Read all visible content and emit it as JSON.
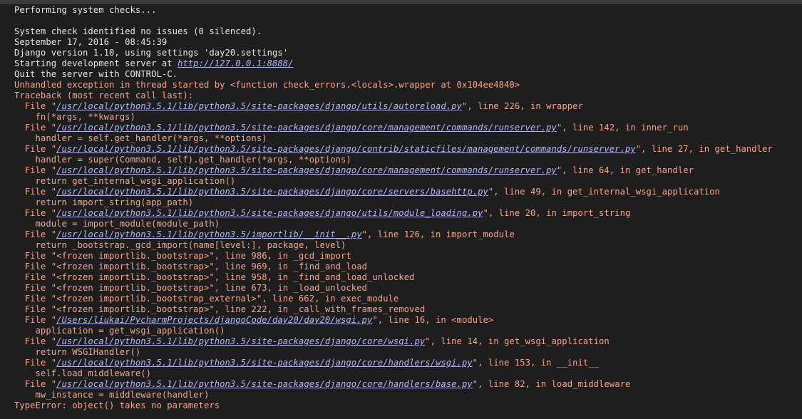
{
  "terminal": {
    "lines": [
      {
        "style": "white",
        "segments": [
          {
            "t": "Performing system checks..."
          }
        ]
      },
      {
        "style": "white",
        "segments": [
          {
            "t": ""
          }
        ]
      },
      {
        "style": "white",
        "segments": [
          {
            "t": "System check identified no issues (0 silenced)."
          }
        ]
      },
      {
        "style": "white",
        "segments": [
          {
            "t": "September 17, 2016 - 08:45:39"
          }
        ]
      },
      {
        "style": "white",
        "segments": [
          {
            "t": "Django version 1.10, using settings 'day20.settings'"
          }
        ]
      },
      {
        "style": "white",
        "segments": [
          {
            "t": "Starting development server at "
          },
          {
            "t": "http://127.0.0.1:8888/",
            "link": true
          }
        ]
      },
      {
        "style": "white",
        "segments": [
          {
            "t": "Quit the server with CONTROL-C."
          }
        ]
      },
      {
        "style": "red",
        "segments": [
          {
            "t": "Unhandled exception in thread started by <function check_errors.<locals>.wrapper at 0x104ee4840>"
          }
        ]
      },
      {
        "style": "red",
        "segments": [
          {
            "t": "Traceback (most recent call last):"
          }
        ]
      },
      {
        "style": "red",
        "segments": [
          {
            "t": "  File \""
          },
          {
            "t": "/usr/local/python3.5.1/lib/python3.5/site-packages/django/utils/autoreload.py",
            "link": true
          },
          {
            "t": "\", line 226, in wrapper"
          }
        ]
      },
      {
        "style": "red",
        "segments": [
          {
            "t": "    fn(*args, **kwargs)"
          }
        ]
      },
      {
        "style": "red",
        "segments": [
          {
            "t": "  File \""
          },
          {
            "t": "/usr/local/python3.5.1/lib/python3.5/site-packages/django/core/management/commands/runserver.py",
            "link": true
          },
          {
            "t": "\", line 142, in inner_run"
          }
        ]
      },
      {
        "style": "red",
        "segments": [
          {
            "t": "    handler = self.get_handler(*args, **options)"
          }
        ]
      },
      {
        "style": "red",
        "segments": [
          {
            "t": "  File \""
          },
          {
            "t": "/usr/local/python3.5.1/lib/python3.5/site-packages/django/contrib/staticfiles/management/commands/runserver.py",
            "link": true
          },
          {
            "t": "\", line 27, in get_handler"
          }
        ]
      },
      {
        "style": "red",
        "segments": [
          {
            "t": "    handler = super(Command, self).get_handler(*args, **options)"
          }
        ]
      },
      {
        "style": "red",
        "segments": [
          {
            "t": "  File \""
          },
          {
            "t": "/usr/local/python3.5.1/lib/python3.5/site-packages/django/core/management/commands/runserver.py",
            "link": true
          },
          {
            "t": "\", line 64, in get_handler"
          }
        ]
      },
      {
        "style": "red",
        "segments": [
          {
            "t": "    return get_internal_wsgi_application()"
          }
        ]
      },
      {
        "style": "red",
        "segments": [
          {
            "t": "  File \""
          },
          {
            "t": "/usr/local/python3.5.1/lib/python3.5/site-packages/django/core/servers/basehttp.py",
            "link": true
          },
          {
            "t": "\", line 49, in get_internal_wsgi_application"
          }
        ]
      },
      {
        "style": "red",
        "segments": [
          {
            "t": "    return import_string(app_path)"
          }
        ]
      },
      {
        "style": "red",
        "segments": [
          {
            "t": "  File \""
          },
          {
            "t": "/usr/local/python3.5.1/lib/python3.5/site-packages/django/utils/module_loading.py",
            "link": true
          },
          {
            "t": "\", line 20, in import_string"
          }
        ]
      },
      {
        "style": "red",
        "segments": [
          {
            "t": "    module = import_module(module_path)"
          }
        ]
      },
      {
        "style": "red",
        "segments": [
          {
            "t": "  File \""
          },
          {
            "t": "/usr/local/python3.5.1/lib/python3.5/importlib/__init__.py",
            "link": true
          },
          {
            "t": "\", line 126, in import_module"
          }
        ]
      },
      {
        "style": "red",
        "segments": [
          {
            "t": "    return _bootstrap._gcd_import(name[level:], package, level)"
          }
        ]
      },
      {
        "style": "red",
        "segments": [
          {
            "t": "  File \"<frozen importlib._bootstrap>\", line 986, in _gcd_import"
          }
        ]
      },
      {
        "style": "red",
        "segments": [
          {
            "t": "  File \"<frozen importlib._bootstrap>\", line 969, in _find_and_load"
          }
        ]
      },
      {
        "style": "red",
        "segments": [
          {
            "t": "  File \"<frozen importlib._bootstrap>\", line 958, in _find_and_load_unlocked"
          }
        ]
      },
      {
        "style": "red",
        "segments": [
          {
            "t": "  File \"<frozen importlib._bootstrap>\", line 673, in _load_unlocked"
          }
        ]
      },
      {
        "style": "red",
        "segments": [
          {
            "t": "  File \"<frozen importlib._bootstrap_external>\", line 662, in exec_module"
          }
        ]
      },
      {
        "style": "red",
        "segments": [
          {
            "t": "  File \"<frozen importlib._bootstrap>\", line 222, in _call_with_frames_removed"
          }
        ]
      },
      {
        "style": "red",
        "segments": [
          {
            "t": "  File \""
          },
          {
            "t": "/Users/liukai/PycharmProjects/djangoCode/day20/day20/wsgi.py",
            "link": true
          },
          {
            "t": "\", line 16, in <module>"
          }
        ]
      },
      {
        "style": "red",
        "segments": [
          {
            "t": "    application = get_wsgi_application()"
          }
        ]
      },
      {
        "style": "red",
        "segments": [
          {
            "t": "  File \""
          },
          {
            "t": "/usr/local/python3.5.1/lib/python3.5/site-packages/django/core/wsgi.py",
            "link": true
          },
          {
            "t": "\", line 14, in get_wsgi_application"
          }
        ]
      },
      {
        "style": "red",
        "segments": [
          {
            "t": "    return WSGIHandler()"
          }
        ]
      },
      {
        "style": "red",
        "segments": [
          {
            "t": "  File \""
          },
          {
            "t": "/usr/local/python3.5.1/lib/python3.5/site-packages/django/core/handlers/wsgi.py",
            "link": true
          },
          {
            "t": "\", line 153, in __init__"
          }
        ]
      },
      {
        "style": "red",
        "segments": [
          {
            "t": "    self.load_middleware()"
          }
        ]
      },
      {
        "style": "red",
        "segments": [
          {
            "t": "  File \""
          },
          {
            "t": "/usr/local/python3.5.1/lib/python3.5/site-packages/django/core/handlers/base.py",
            "link": true
          },
          {
            "t": "\", line 82, in load_middleware"
          }
        ]
      },
      {
        "style": "red",
        "segments": [
          {
            "t": "    mw_instance = middleware(handler)"
          }
        ]
      },
      {
        "style": "red",
        "segments": [
          {
            "t": "TypeError: object() takes no parameters"
          }
        ]
      }
    ]
  }
}
